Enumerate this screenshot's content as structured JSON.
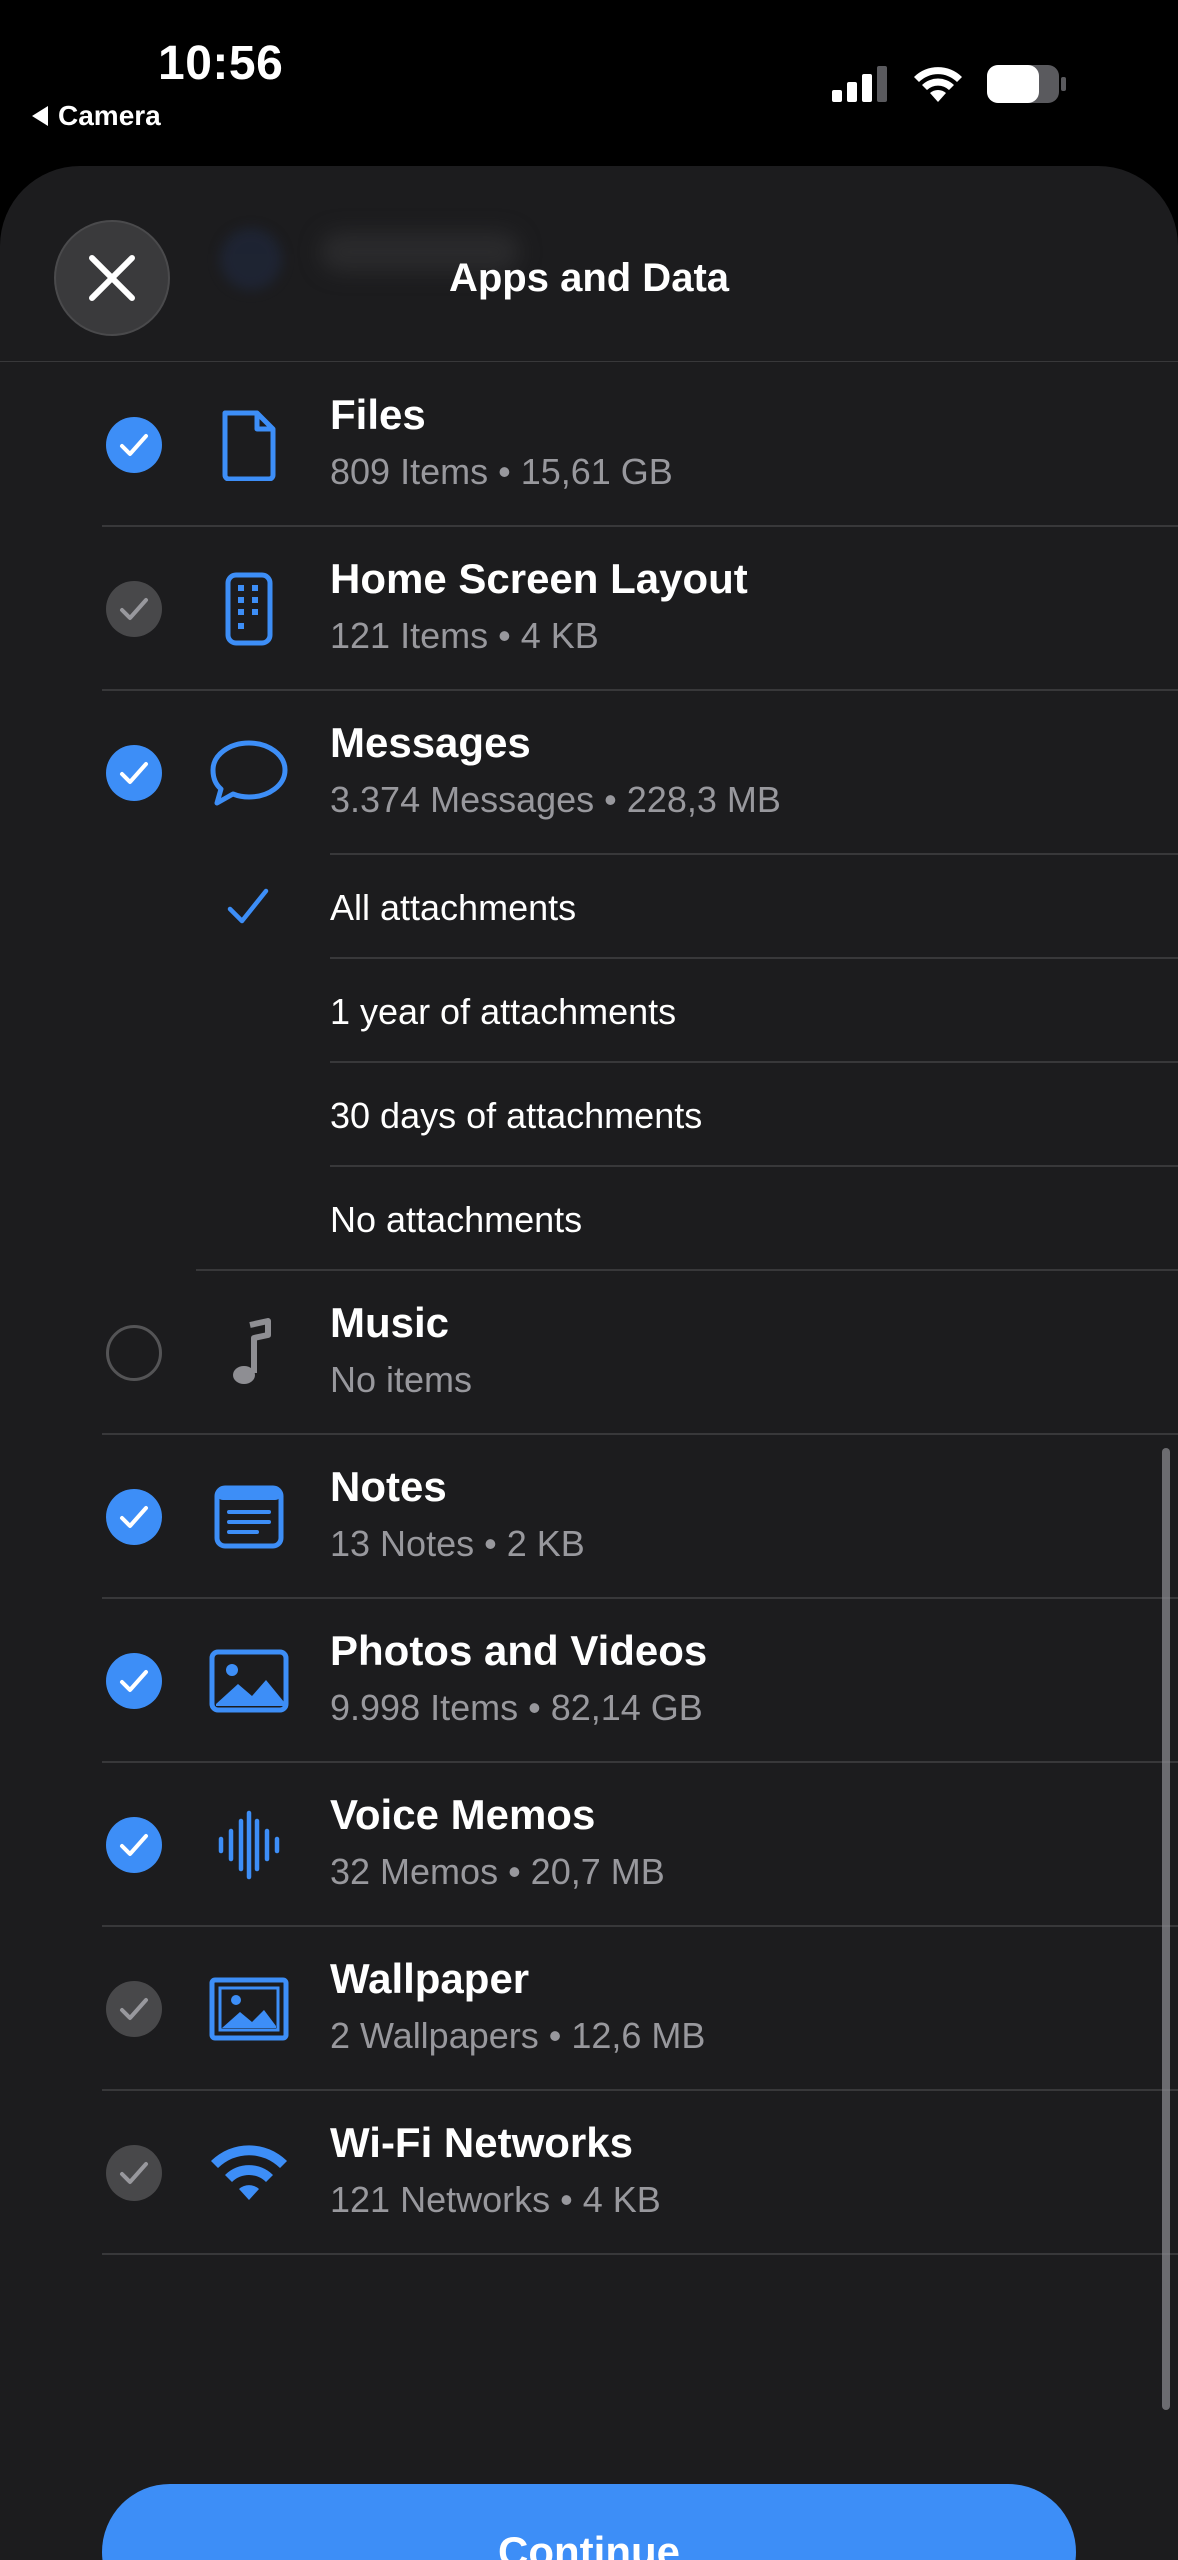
{
  "status_bar": {
    "time": "10:56",
    "back_label": "Camera"
  },
  "sheet": {
    "title": "Apps and Data",
    "continue_label": "Continue"
  },
  "colors": {
    "accent": "#3d8ef7",
    "background": "#1c1c1e",
    "secondary_text": "#98989d"
  },
  "items": [
    {
      "title": "Files",
      "subtitle": "809 Items • 15,61 GB",
      "state": "checked",
      "icon": "document-icon"
    },
    {
      "title": "Home Screen Layout",
      "subtitle": "121 Items • 4 KB",
      "state": "checked-disabled",
      "icon": "phone-grid-icon"
    },
    {
      "title": "Messages",
      "subtitle": "3.374 Messages • 228,3 MB",
      "state": "checked",
      "icon": "speech-bubble-icon"
    },
    {
      "title": "Music",
      "subtitle": "No items",
      "state": "unchecked",
      "icon": "music-note-icon"
    },
    {
      "title": "Notes",
      "subtitle": "13 Notes • 2 KB",
      "state": "checked",
      "icon": "note-icon"
    },
    {
      "title": "Photos and Videos",
      "subtitle": "9.998 Items • 82,14 GB",
      "state": "checked",
      "icon": "photo-icon"
    },
    {
      "title": "Voice Memos",
      "subtitle": "32 Memos • 20,7 MB",
      "state": "checked",
      "icon": "waveform-icon"
    },
    {
      "title": "Wallpaper",
      "subtitle": "2 Wallpapers • 12,6 MB",
      "state": "checked-disabled",
      "icon": "wallpaper-icon"
    },
    {
      "title": "Wi-Fi Networks",
      "subtitle": "121 Networks • 4 KB",
      "state": "checked-disabled",
      "icon": "wifi-icon"
    }
  ],
  "message_options": [
    {
      "label": "All attachments",
      "selected": true
    },
    {
      "label": "1 year of attachments",
      "selected": false
    },
    {
      "label": "30 days of attachments",
      "selected": false
    },
    {
      "label": "No attachments",
      "selected": false
    }
  ]
}
